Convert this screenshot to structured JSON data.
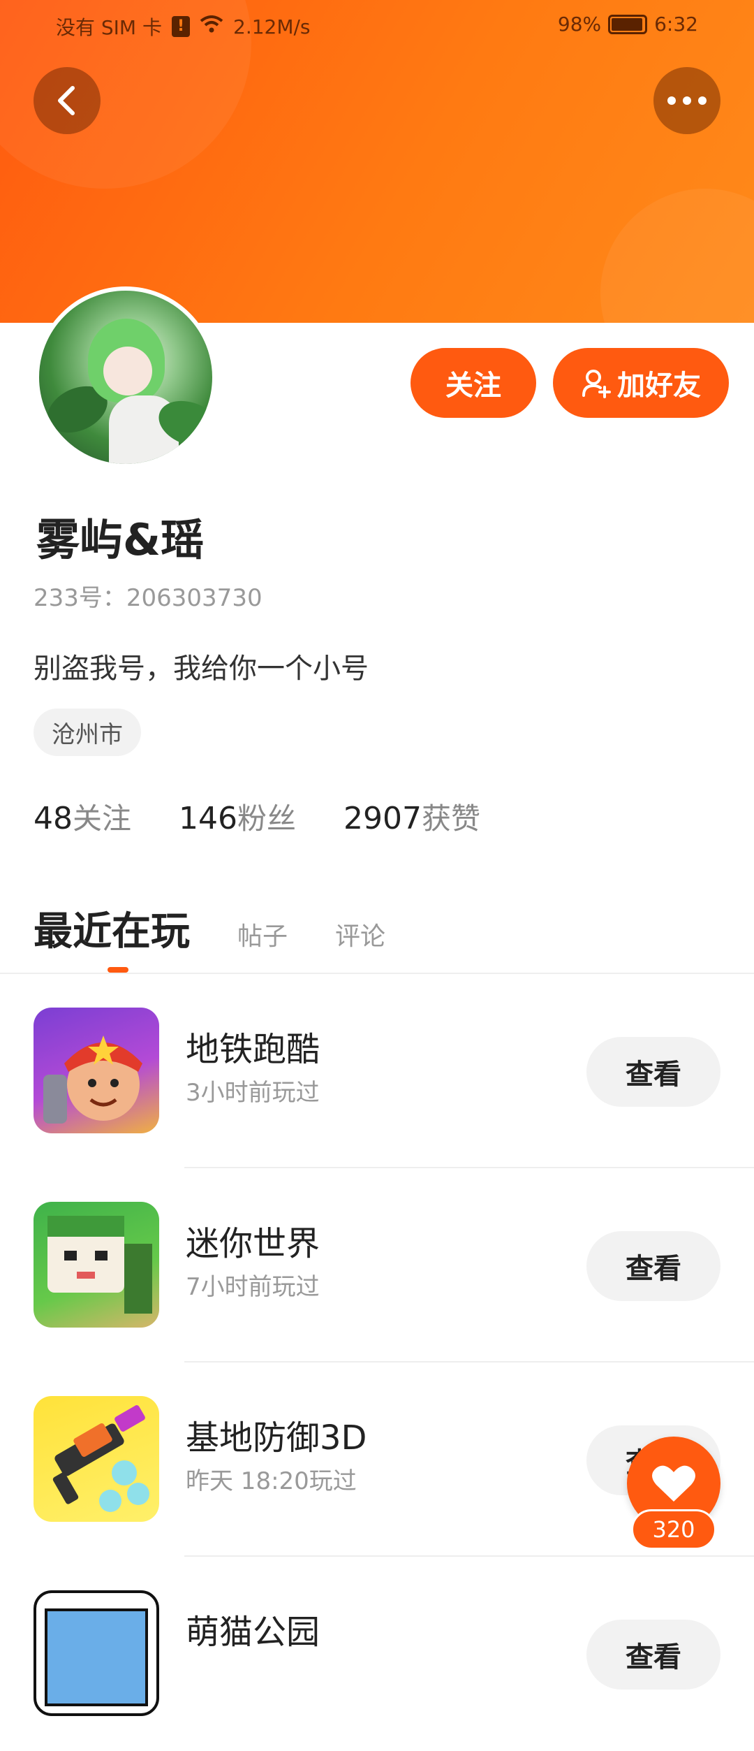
{
  "status_bar": {
    "carrier": "没有 SIM 卡",
    "speed": "2.12M/s",
    "battery": "98%",
    "time": "6:32"
  },
  "header": {
    "back_icon": "chevron-left-icon",
    "more_icon": "more-horizontal-icon",
    "accent": "#ff5a10"
  },
  "profile": {
    "name": "雾屿&瑶",
    "uid": "233号：206303730",
    "bio": "别盗我号，我给你一个小号",
    "location": "沧州市",
    "follow_label": "关注",
    "add_friend_label": "加好友",
    "stats": [
      {
        "num": "48",
        "label": "关注"
      },
      {
        "num": "146",
        "label": "粉丝"
      },
      {
        "num": "2907",
        "label": "获赞"
      }
    ]
  },
  "tabs": [
    {
      "label": "最近在玩",
      "active": true
    },
    {
      "label": "帖子",
      "active": false
    },
    {
      "label": "评论",
      "active": false
    }
  ],
  "games": [
    {
      "name": "地铁跑酷",
      "time": "3小时前玩过",
      "button": "查看"
    },
    {
      "name": "迷你世界",
      "time": "7小时前玩过",
      "button": "查看"
    },
    {
      "name": "基地防御3D",
      "time": "昨天  18:20玩过",
      "button": "查看"
    },
    {
      "name": "萌猫公园",
      "time": "",
      "button": "查看"
    }
  ],
  "like": {
    "icon": "heart-icon",
    "count": "320"
  }
}
